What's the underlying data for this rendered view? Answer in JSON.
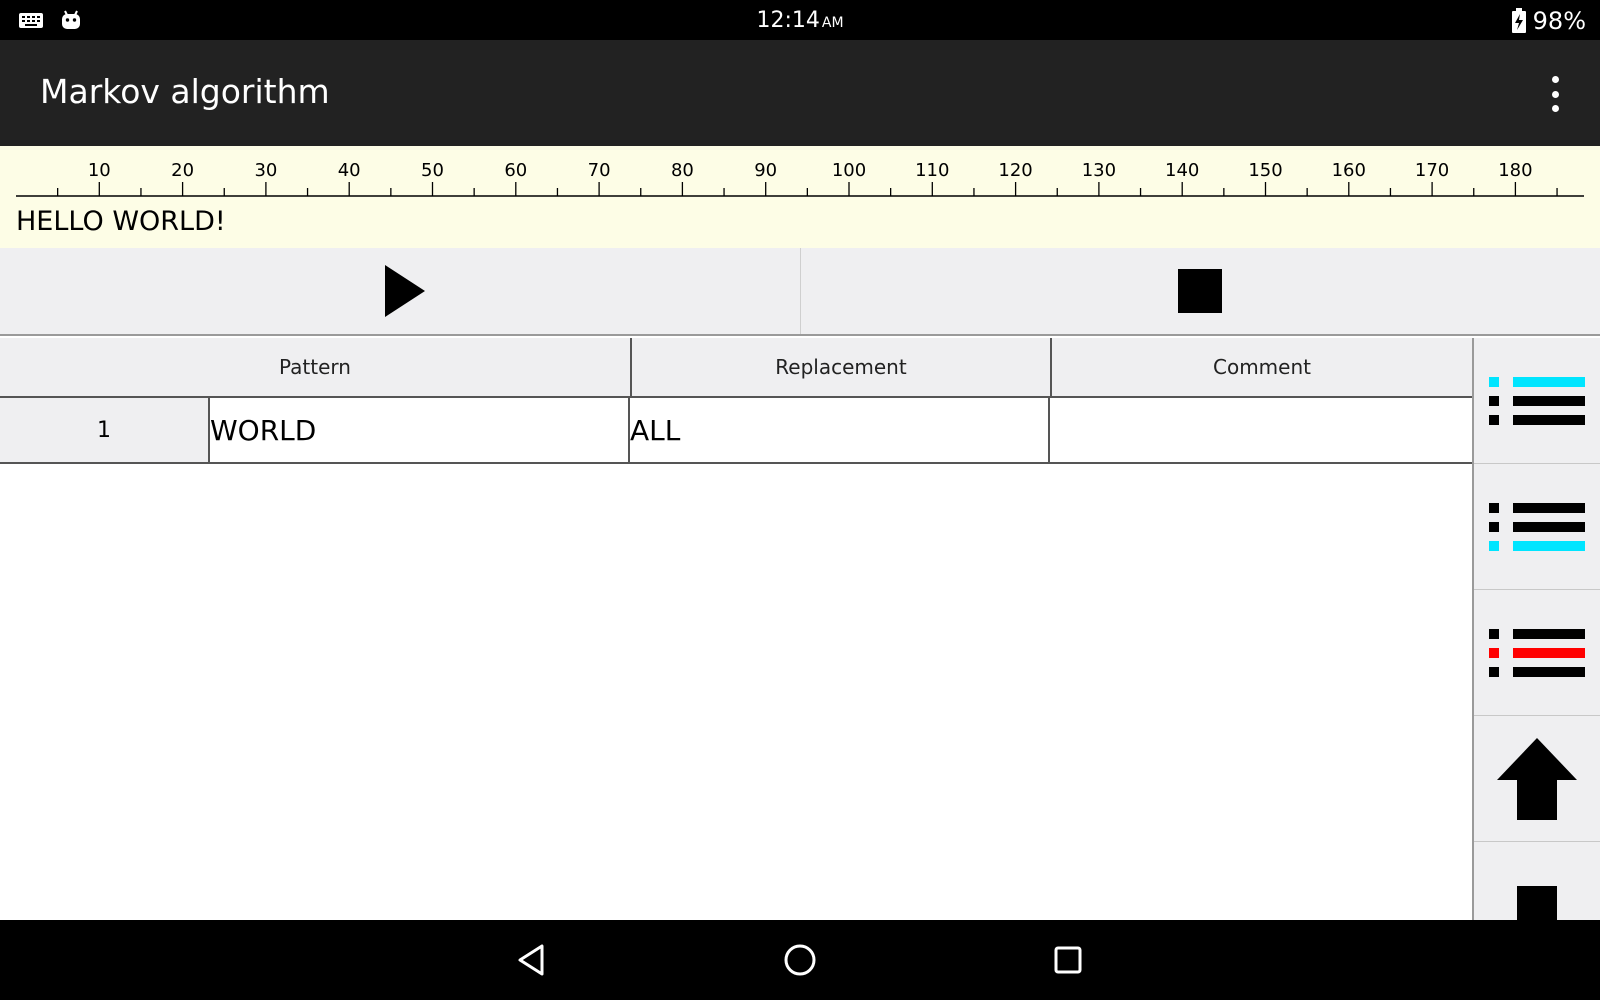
{
  "status_bar": {
    "time": "12:14",
    "ampm": "AM",
    "battery": "98%",
    "icons": [
      "keyboard-icon",
      "android-icon",
      "battery-charging-icon"
    ]
  },
  "app_bar": {
    "title": "Markov algorithm",
    "menu_icon": "more-vert-icon"
  },
  "tape": {
    "ruler_labels": [
      "10",
      "20",
      "30",
      "40",
      "50",
      "60",
      "70",
      "80",
      "90",
      "100",
      "110",
      "120",
      "130",
      "140",
      "150",
      "160",
      "170",
      "180"
    ],
    "text": "HELLO WORLD!"
  },
  "controls": {
    "play_icon": "play-icon",
    "stop_icon": "stop-icon"
  },
  "table": {
    "headers": [
      "Pattern",
      "Replacement",
      "Comment"
    ],
    "rows": [
      {
        "num": "1",
        "pattern": "WORLD",
        "replacement": "ALL",
        "comment": ""
      }
    ]
  },
  "side_toolbar": {
    "buttons": [
      "insert-rule-before-icon",
      "insert-rule-after-icon",
      "delete-rule-icon",
      "move-up-icon",
      "move-down-icon"
    ]
  },
  "colors": {
    "accent_cyan": "#00e5ff",
    "delete_red": "#ff0000",
    "tape_bg": "#fdfde6",
    "app_bar_bg": "#222222"
  },
  "nav_bar": {
    "icons": [
      "back-icon",
      "home-icon",
      "recents-icon"
    ]
  }
}
